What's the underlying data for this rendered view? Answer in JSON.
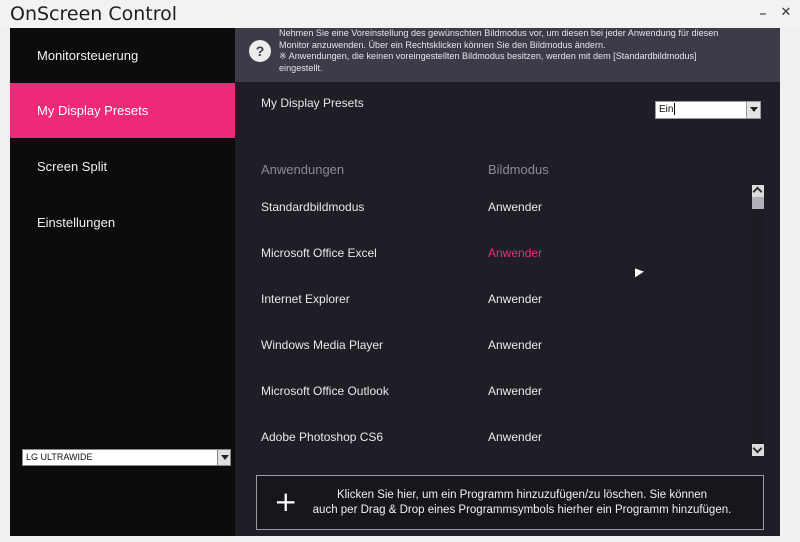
{
  "window": {
    "title": "OnScreen Control",
    "minimize_glyph": "–",
    "close_glyph": "✕"
  },
  "sidebar": {
    "items": [
      {
        "label": "Monitorsteuerung",
        "active": false
      },
      {
        "label": "My Display Presets",
        "active": true
      },
      {
        "label": "Screen Split",
        "active": false
      },
      {
        "label": "Einstellungen",
        "active": false
      }
    ],
    "monitor_select": {
      "value": "LG ULTRAWIDE"
    }
  },
  "info": {
    "icon": "question-icon",
    "line1": "Nehmen Sie eine Voreinstellung des gewünschten Bildmodus vor, um diesen bei jeder Anwendung für diesen",
    "line2": "Monitor anzuwenden. Über ein Rechtsklicken können Sie den Bildmodus ändern.",
    "line3": "※ Anwendungen, die keinen voreingestellten Bildmodus besitzen, werden mit dem [Standardbildmodus]",
    "line4": "eingestellt."
  },
  "presets": {
    "title": "My Display Presets",
    "toggle_value": "Ein",
    "columns": {
      "app": "Anwendungen",
      "mode": "Bildmodus"
    },
    "rows": [
      {
        "app": "Standardbildmodus",
        "mode": "Anwender",
        "highlight": false
      },
      {
        "app": "Microsoft Office Excel",
        "mode": "Anwender",
        "highlight": true
      },
      {
        "app": "Internet Explorer",
        "mode": "Anwender",
        "highlight": false
      },
      {
        "app": "Windows Media Player",
        "mode": "Anwender",
        "highlight": false
      },
      {
        "app": "Microsoft Office Outlook",
        "mode": "Anwender",
        "highlight": false
      },
      {
        "app": "Adobe Photoshop CS6",
        "mode": "Anwender",
        "highlight": false
      }
    ]
  },
  "add_program": {
    "line1": "Klicken Sie hier, um ein Programm hinzuzufügen/zu löschen. Sie können",
    "line2": "auch per Drag & Drop eines Programmsymbols hierher ein Programm hinzufügen.",
    "icon": "plus-icon"
  },
  "colors": {
    "accent": "#ee2a78",
    "sidebar_bg": "#0c0c0e",
    "main_bg": "#1f1e26",
    "info_bg": "#3c3c48"
  }
}
